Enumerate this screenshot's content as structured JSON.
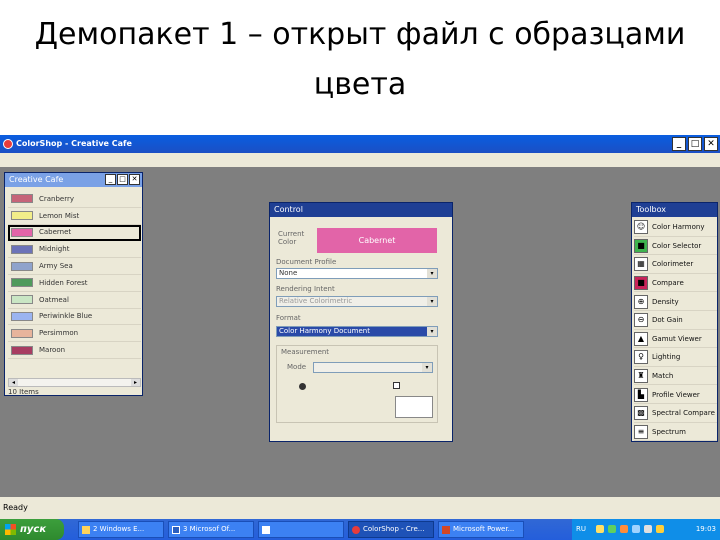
{
  "slide": {
    "title_line1": "Демопакет 1 – открыт файл с образцами",
    "title_line2": "цвета"
  },
  "app": {
    "title": "ColorShop - Creative Cafe",
    "min": "_",
    "max": "□",
    "close": "✕"
  },
  "cafe_panel": {
    "title": "Creative Cafe",
    "items": [
      {
        "label": "Cranberry",
        "color": "#c66479"
      },
      {
        "label": "Lemon Mist",
        "color": "#f2ee8a"
      },
      {
        "label": "Cabernet",
        "color": "#e264a8"
      },
      {
        "label": "Midnight",
        "color": "#6c73b8"
      },
      {
        "label": "Army Sea",
        "color": "#8fa3cc"
      },
      {
        "label": "Hidden Forest",
        "color": "#4f9a5c"
      },
      {
        "label": "Oatmeal",
        "color": "#c9e6c4"
      },
      {
        "label": "Periwinkle Blue",
        "color": "#9bb4f0"
      },
      {
        "label": "Persimmon",
        "color": "#e7b49c"
      },
      {
        "label": "Maroon",
        "color": "#a83d62"
      }
    ],
    "count": "10 Items"
  },
  "control": {
    "title": "Control",
    "current_label": "Current Color",
    "current_value": "Cabernet",
    "document_label": "Document Profile",
    "document_value": "None",
    "rendering_label": "Rendering Intent",
    "rendering_value": "Relative Colorimetric",
    "format_label": "Format",
    "format_value": "Color Harmony Document",
    "group_label": "Measurement",
    "mode_label": "Mode"
  },
  "toolbox": {
    "title": "Toolbox",
    "items": [
      {
        "label": "Color Harmony",
        "icon": "☺"
      },
      {
        "label": "Color Selector",
        "icon": "■"
      },
      {
        "label": "Colorimeter",
        "icon": "▦"
      },
      {
        "label": "Compare",
        "icon": "■"
      },
      {
        "label": "Density",
        "icon": "⊕"
      },
      {
        "label": "Dot Gain",
        "icon": "⊖"
      },
      {
        "label": "Gamut Viewer",
        "icon": "▲"
      },
      {
        "label": "Lighting",
        "icon": "♀"
      },
      {
        "label": "Match",
        "icon": "♜"
      },
      {
        "label": "Profile Viewer",
        "icon": "▙"
      },
      {
        "label": "Spectral Compare",
        "icon": "▩"
      },
      {
        "label": "Spectrum",
        "icon": "≡"
      }
    ]
  },
  "status": {
    "text": "Ready"
  },
  "taskbar": {
    "start": "пуск",
    "tasks": [
      "2 Windows E...",
      "3 Microsof Of...",
      "",
      "ColorShop - Cre...",
      "Microsoft Power..."
    ],
    "lang": "RU",
    "clock": "19:03"
  }
}
